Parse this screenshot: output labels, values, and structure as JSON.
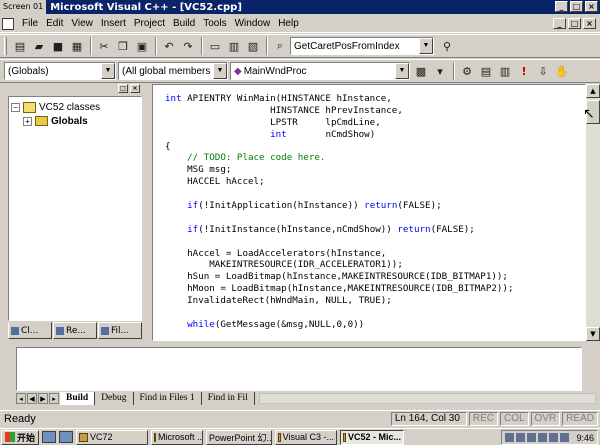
{
  "title_bar": {
    "screen_label": "Screen 01",
    "app_title": "Microsoft Visual C++ - [VC52.cpp]"
  },
  "menu": [
    "File",
    "Edit",
    "View",
    "Insert",
    "Project",
    "Build",
    "Tools",
    "Window",
    "Help"
  ],
  "toolbar": {
    "find_combo": "GetCaretPosFromIndex",
    "scope_combo": "(Globals)",
    "members_combo": "(All global members",
    "function_combo": "MainWndProc"
  },
  "workspace": {
    "tree": [
      {
        "label": "VC52 classes",
        "expander": "−"
      },
      {
        "label": "Globals",
        "expander": "+"
      }
    ],
    "tabs": [
      "Cl...",
      "Re...",
      "Fil..."
    ]
  },
  "code_lines": [
    [
      {
        "t": "int",
        "c": "kw"
      },
      {
        "t": " APIENTRY WinMain(HINSTANCE hInstance,",
        "c": ""
      }
    ],
    [
      {
        "t": "                   HINSTANCE hPrevInstance,",
        "c": ""
      }
    ],
    [
      {
        "t": "                   LPSTR     lpCmdLine,",
        "c": ""
      }
    ],
    [
      {
        "t": "                   ",
        "c": ""
      },
      {
        "t": "int",
        "c": "kw"
      },
      {
        "t": "       nCmdShow)",
        "c": ""
      }
    ],
    [
      {
        "t": "{",
        "c": ""
      }
    ],
    [
      {
        "t": "    ",
        "c": ""
      },
      {
        "t": "// TODO: Place code here.",
        "c": "cm"
      }
    ],
    [
      {
        "t": "    MSG msg;",
        "c": ""
      }
    ],
    [
      {
        "t": "    HACCEL hAccel;",
        "c": ""
      }
    ],
    [
      {
        "t": "",
        "c": ""
      }
    ],
    [
      {
        "t": "    ",
        "c": ""
      },
      {
        "t": "if",
        "c": "kw"
      },
      {
        "t": "(!InitApplication(hInstance)) ",
        "c": ""
      },
      {
        "t": "return",
        "c": "kw"
      },
      {
        "t": "(FALSE);",
        "c": ""
      }
    ],
    [
      {
        "t": "",
        "c": ""
      }
    ],
    [
      {
        "t": "    ",
        "c": ""
      },
      {
        "t": "if",
        "c": "kw"
      },
      {
        "t": "(!InitInstance(hInstance,nCmdShow)) ",
        "c": ""
      },
      {
        "t": "return",
        "c": "kw"
      },
      {
        "t": "(FALSE);",
        "c": ""
      }
    ],
    [
      {
        "t": "",
        "c": ""
      }
    ],
    [
      {
        "t": "    hAccel = LoadAccelerators(hInstance,",
        "c": ""
      }
    ],
    [
      {
        "t": "        MAKEINTRESOURCE(IDR_ACCELERATOR1));",
        "c": ""
      }
    ],
    [
      {
        "t": "    hSun = LoadBitmap(hInstance,MAKEINTRESOURCE(IDB_BITMAP1));",
        "c": ""
      }
    ],
    [
      {
        "t": "    hMoon = LoadBitmap(hInstance,MAKEINTRESOURCE(IDB_BITMAP2));",
        "c": ""
      }
    ],
    [
      {
        "t": "    InvalidateRect(hWndMain, NULL, TRUE);",
        "c": ""
      }
    ],
    [
      {
        "t": "",
        "c": ""
      }
    ],
    [
      {
        "t": "    ",
        "c": ""
      },
      {
        "t": "while",
        "c": "kw"
      },
      {
        "t": "(GetMessage(&msg,NULL,0,0))",
        "c": ""
      }
    ]
  ],
  "output_tabs": [
    "Build",
    "Debug",
    "Find in Files 1",
    "Find in Fil"
  ],
  "status": {
    "text": "Ready",
    "position": "Ln 164, Col 30",
    "rec": "REC",
    "col": "COL",
    "ovr": "OVR",
    "read": "READ"
  },
  "taskbar": {
    "start_label": "开始",
    "tasks": [
      "VC72",
      "Microsoft ...",
      "PowerPoint 幻...",
      "Visual C3 -...",
      "VC52 - Mic..."
    ],
    "clock": "9:46"
  }
}
